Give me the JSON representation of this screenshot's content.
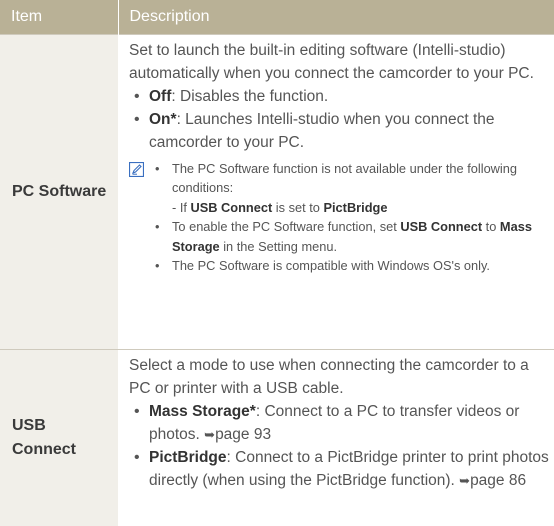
{
  "header": {
    "item": "Item",
    "description": "Description"
  },
  "rows": {
    "pc_software": {
      "item": "PC Software",
      "intro": "Set to launch the built-in editing software (Intelli-studio) automatically when you connect the camcorder to your PC.",
      "off_label": "Off",
      "off_text": ": Disables the function.",
      "on_label": "On*",
      "on_text": ": Launches Intelli-studio when you connect the camcorder to your PC.",
      "note1": "The PC Software function is not available under the following conditions:",
      "note1_sub_prefix": "- If ",
      "note1_sub_b1": "USB Connect",
      "note1_sub_mid": " is set to ",
      "note1_sub_b2": "PictBridge",
      "note2_a": "To enable the PC Software function, set ",
      "note2_b1": "USB Connect",
      "note2_c": " to ",
      "note2_b2": "Mass Storage",
      "note2_d": " in the Setting menu.",
      "note3": "The PC Software is compatible with Windows OS's only."
    },
    "usb_connect": {
      "item": "USB Connect",
      "intro": "Select a mode to use when connecting the camcorder to a PC or printer with a USB cable.",
      "mass_label": "Mass Storage*",
      "mass_text": ": Connect to a PC to transfer videos or photos. ",
      "mass_page": "page 93",
      "pict_label": "PictBridge",
      "pict_text": ": Connect to a PictBridge printer to print photos directly (when using the PictBridge function). ",
      "pict_page": "page 86"
    }
  },
  "colors": {
    "header_bg": "#b9b196",
    "item_bg": "#f1efe9",
    "note_icon": "#3a6fc0"
  },
  "icons": {
    "note": "note-pencil-icon",
    "arrow": "arrow-right-icon"
  }
}
